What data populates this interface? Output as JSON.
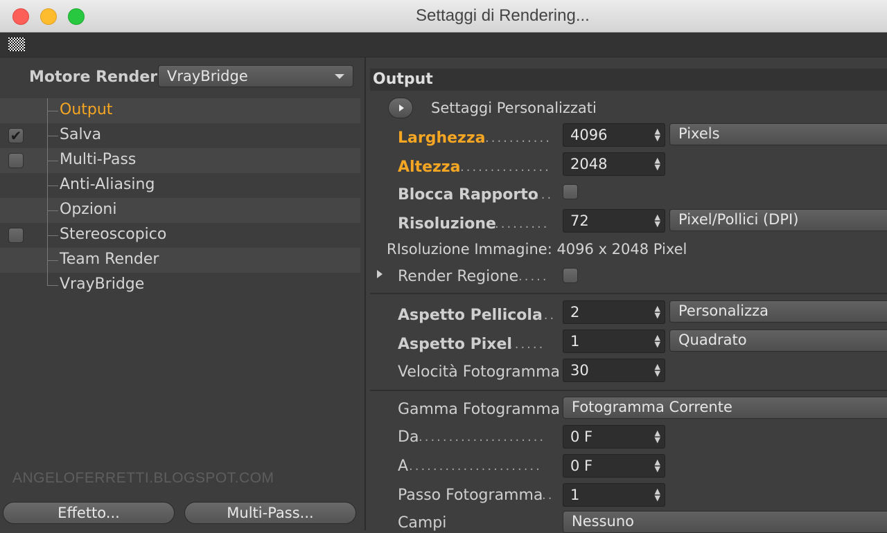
{
  "window": {
    "title": "Settaggi di Rendering..."
  },
  "left": {
    "engine_label": "Motore Render",
    "engine_value": "VrayBridge",
    "tree": [
      {
        "label": "Output",
        "active": true,
        "check": "none"
      },
      {
        "label": "Salva",
        "active": false,
        "check": "checked"
      },
      {
        "label": "Multi-Pass",
        "active": false,
        "check": "unchecked"
      },
      {
        "label": "Anti-Aliasing",
        "active": false,
        "check": "none"
      },
      {
        "label": "Opzioni",
        "active": false,
        "check": "none"
      },
      {
        "label": "Stereoscopico",
        "active": false,
        "check": "unchecked"
      },
      {
        "label": "Team Render",
        "active": false,
        "check": "none"
      },
      {
        "label": "VrayBridge",
        "active": false,
        "check": "none"
      }
    ],
    "checkmark": "✔",
    "watermark": "ANGELOFERRETTI.BLOGSPOT.COM",
    "effect_button": "Effetto...",
    "multipass_button": "Multi-Pass..."
  },
  "right": {
    "section_title": "Output",
    "preset_label": "Settaggi  Personalizzati",
    "width_label": "Larghezza",
    "width_value": "4096",
    "width_unit": "Pixels",
    "height_label": "Altezza",
    "height_value": "2048",
    "lock_ratio_label": "Blocca Rapporto",
    "resolution_label": "Risoluzione",
    "resolution_value": "72",
    "resolution_unit": "Pixel/Pollici (DPI)",
    "image_resolution": "RIsoluzione Immagine: 4096 x 2048 Pixel",
    "render_region_label": "Render Regione",
    "film_aspect_label": "Aspetto Pellicola",
    "film_aspect_value": "2",
    "film_aspect_preset": "Personalizza",
    "pixel_aspect_label": "Aspetto Pixel",
    "pixel_aspect_value": "1",
    "pixel_aspect_preset": "Quadrato",
    "frame_rate_label": "Velocità Fotogramma",
    "frame_rate_value": "30",
    "frame_range_label": "Gamma Fotogramma",
    "frame_range_value": "Fotogramma Corrente",
    "from_label": "Da",
    "from_value": "0 F",
    "to_label": "A",
    "to_value": "0 F",
    "frame_step_label": "Passo Fotogramma",
    "frame_step_value": "1",
    "fields_label": "Campi",
    "fields_value": "Nessuno"
  }
}
